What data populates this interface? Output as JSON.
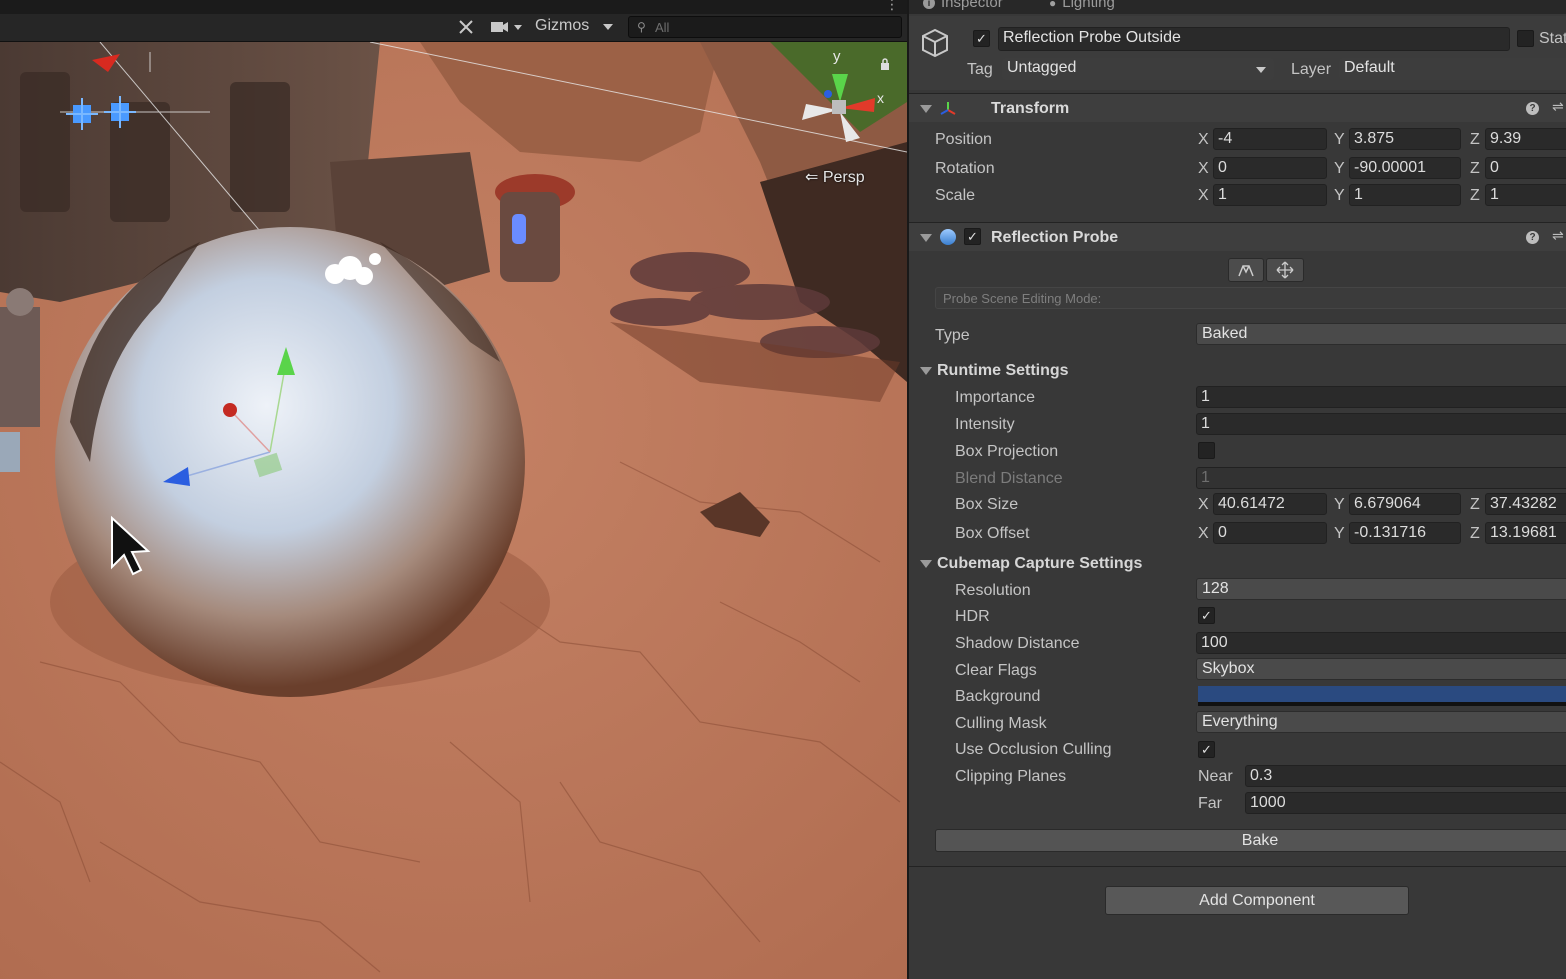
{
  "scene": {
    "toolbar": {
      "gizmos_label": "Gizmos",
      "search_placeholder": "All"
    },
    "orientation_gizmo": {
      "y_label": "y",
      "x_label": "x",
      "persp_label": "Persp"
    },
    "colors": {
      "ground": "#b9775a",
      "sphere": "#cfd6e4",
      "gizmo_y": "#5ad44a",
      "gizmo_x": "#e23a2a",
      "gizmo_z": "#2b5ee0"
    }
  },
  "inspector": {
    "tabs": [
      {
        "label": "Inspector",
        "icon": "info-icon"
      },
      {
        "label": "Lighting",
        "icon": "lightbulb-icon"
      }
    ],
    "object": {
      "name": "Reflection Probe Outside",
      "active": true,
      "static_label": "Stat",
      "tag_label": "Tag",
      "tag_value": "Untagged",
      "layer_label": "Layer",
      "layer_value": "Default"
    },
    "transform": {
      "title": "Transform",
      "rows": [
        {
          "label": "Position",
          "x": "-4",
          "y": "3.875",
          "z": "9.39"
        },
        {
          "label": "Rotation",
          "x": "0",
          "y": "-90.00001",
          "z": "0"
        },
        {
          "label": "Scale",
          "x": "1",
          "y": "1",
          "z": "1"
        }
      ]
    },
    "reflection_probe": {
      "title": "Reflection Probe",
      "enabled": true,
      "editing_mode_label": "Probe Scene Editing Mode:",
      "type_label": "Type",
      "type_value": "Baked",
      "runtime_settings": {
        "title": "Runtime Settings",
        "importance_label": "Importance",
        "importance": "1",
        "intensity_label": "Intensity",
        "intensity": "1",
        "box_projection_label": "Box Projection",
        "box_projection": false,
        "blend_distance_label": "Blend Distance",
        "blend_distance": "1",
        "box_size_label": "Box Size",
        "box_size": {
          "x": "40.61472",
          "y": "6.679064",
          "z": "37.43282"
        },
        "box_offset_label": "Box Offset",
        "box_offset": {
          "x": "0",
          "y": "-0.131716",
          "z": "13.19681"
        }
      },
      "cubemap_capture": {
        "title": "Cubemap Capture Settings",
        "resolution_label": "Resolution",
        "resolution": "128",
        "hdr_label": "HDR",
        "hdr": true,
        "shadow_distance_label": "Shadow Distance",
        "shadow_distance": "100",
        "clear_flags_label": "Clear Flags",
        "clear_flags": "Skybox",
        "background_label": "Background",
        "background_color": "#2a4a80",
        "culling_mask_label": "Culling Mask",
        "culling_mask": "Everything",
        "occlusion_label": "Use Occlusion Culling",
        "occlusion": true,
        "clipping_label": "Clipping Planes",
        "near_label": "Near",
        "near": "0.3",
        "far_label": "Far",
        "far": "1000"
      },
      "bake_label": "Bake"
    },
    "add_component_label": "Add Component",
    "axis_labels": {
      "x": "X",
      "y": "Y",
      "z": "Z"
    }
  }
}
